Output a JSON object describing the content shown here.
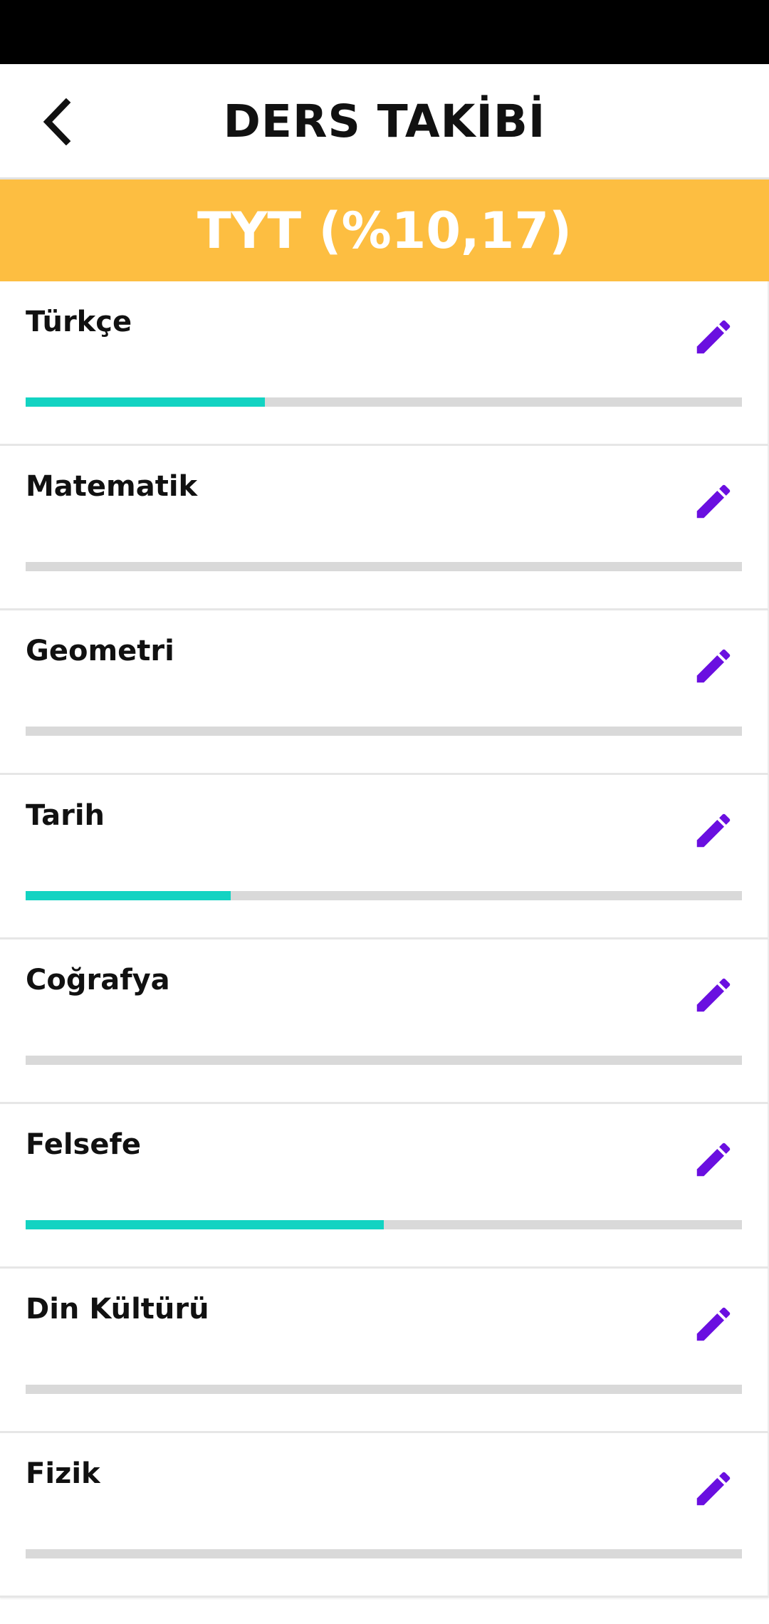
{
  "header": {
    "title": "DERS TAKİBİ",
    "back_icon": "chevron-left-icon"
  },
  "section": {
    "title": "TYT (%10,17)",
    "color": "#FDBE41"
  },
  "colors": {
    "progress_fill": "#13D3C2",
    "progress_track": "#D9D9D9",
    "edit_icon": "#6A0FE0"
  },
  "courses": [
    {
      "name": "Türkçe",
      "progress": 0.334,
      "edit_icon": "pencil-icon"
    },
    {
      "name": "Matematik",
      "progress": 0,
      "edit_icon": "pencil-icon"
    },
    {
      "name": "Geometri",
      "progress": 0,
      "edit_icon": "pencil-icon"
    },
    {
      "name": "Tarih",
      "progress": 0.286,
      "edit_icon": "pencil-icon"
    },
    {
      "name": "Coğrafya",
      "progress": 0,
      "edit_icon": "pencil-icon"
    },
    {
      "name": "Felsefe",
      "progress": 0.5,
      "edit_icon": "pencil-icon"
    },
    {
      "name": "Din Kültürü",
      "progress": 0,
      "edit_icon": "pencil-icon"
    },
    {
      "name": "Fizik",
      "progress": 0,
      "edit_icon": "pencil-icon"
    }
  ]
}
